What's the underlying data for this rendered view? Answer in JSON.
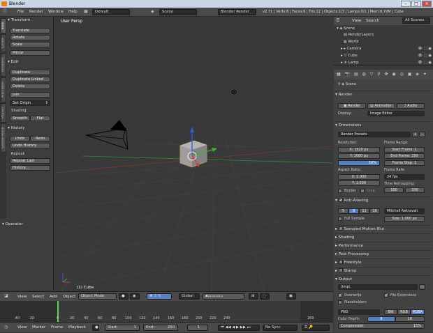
{
  "window": {
    "title": "Blender",
    "min": "–",
    "max": "□",
    "close": "×"
  },
  "infobar": {
    "menus": [
      "File",
      "Render",
      "Window",
      "Help"
    ],
    "layout": "Default",
    "scene": "Scene",
    "engine": "Blender Render",
    "stats": "v2.71 | Verts:8 | Faces:6 | Tris:12 | Objects:1/3 | Lamps:0/1 | Mem:8.70M | Cube"
  },
  "toolshelf": {
    "tabs": [
      "Tools",
      "Create",
      "Relations",
      "Animation",
      "Physics",
      "Grease Pencil"
    ],
    "transform": {
      "header": "Transform",
      "buttons": [
        "Translate",
        "Rotate",
        "Scale",
        "Mirror"
      ]
    },
    "edit": {
      "header": "Edit",
      "buttons": [
        "Duplicate",
        "Duplicate Linked",
        "Delete",
        "Join"
      ],
      "set_origin": "Set Origin"
    },
    "shading": {
      "label": "Shading:",
      "smooth": "Smooth",
      "flat": "Flat"
    },
    "history": {
      "header": "History",
      "undo": "Undo",
      "redo": "Redo",
      "undo_history": "Undo History",
      "repeat_label": "Repeat:",
      "repeat_last": "Repeat Last",
      "history": "History..."
    },
    "operator": {
      "header": "Operator"
    }
  },
  "viewport": {
    "label": "User Persp",
    "object": "(1) Cube"
  },
  "view3d_header": {
    "menus": [
      "View",
      "Select",
      "Add",
      "Object"
    ],
    "mode": "Object Mode",
    "orientation": "Global"
  },
  "timeline": {
    "ticks": [
      "-40",
      "-20",
      "0",
      "20",
      "40",
      "60",
      "80",
      "100",
      "120",
      "140",
      "160",
      "180",
      "200",
      "220",
      "240",
      "260"
    ],
    "menus": [
      "View",
      "Marker",
      "Frame",
      "Playback"
    ],
    "start": "Start:",
    "start_val": "1",
    "end": "End:",
    "end_val": "250",
    "current": "1",
    "sync": "No Sync"
  },
  "outliner": {
    "menus": [
      "View",
      "Search"
    ],
    "filter": "All Scenes",
    "items": [
      "Scene",
      "RenderLayers",
      "World",
      "Camera",
      "Cube",
      "Lamp"
    ]
  },
  "properties": {
    "context": "Scene",
    "render": {
      "header": "Render",
      "render_btn": "Render",
      "animation_btn": "Animation",
      "audio_btn": "Audio",
      "display_label": "Display:",
      "display_val": "Image Editor"
    },
    "dimensions": {
      "header": "Dimensions",
      "presets": "Render Presets",
      "resolution_label": "Resolution:",
      "res_x": "X:   1920 px",
      "res_y": "Y:   1080 px",
      "res_pct": "50%",
      "frame_range_label": "Frame Range:",
      "start_frame": "Start Frame:   1",
      "end_frame": "End Frame:  250",
      "frame_step": "Frame Step:   1",
      "aspect_label": "Aspect Ratio:",
      "asp_x": "X:   1.000",
      "asp_y": "Y:   1.000",
      "frame_rate_label": "Frame Rate:",
      "fps": "24 fps",
      "time_remap_label": "Time Remapping:",
      "remap_old": "100",
      "remap_new": "100",
      "border": "Border",
      "crop": "Crop"
    },
    "aa": {
      "header": "Anti-Aliasing",
      "samples": [
        "5",
        "8",
        "11",
        "16"
      ],
      "filter": "Mitchell-Netravali",
      "full_sample": "Full Sample",
      "size": "Size:   1.000 px"
    },
    "panels": [
      "Sampled Motion Blur",
      "Shading",
      "Performance",
      "Post Processing",
      "Freestyle",
      "Stamp"
    ],
    "output": {
      "header": "Output",
      "path": "/tmp\\",
      "overwrite": "Overwrite",
      "file_ext": "File Extensions",
      "placeholders": "Placeholders",
      "format": "PNG",
      "bw": "BW",
      "rgb": "RGB",
      "rgba": "RGBA",
      "color_depth_label": "Color Depth:",
      "depth8": "8",
      "depth16": "16",
      "compression": "Compression:",
      "compression_val": "15%"
    }
  }
}
